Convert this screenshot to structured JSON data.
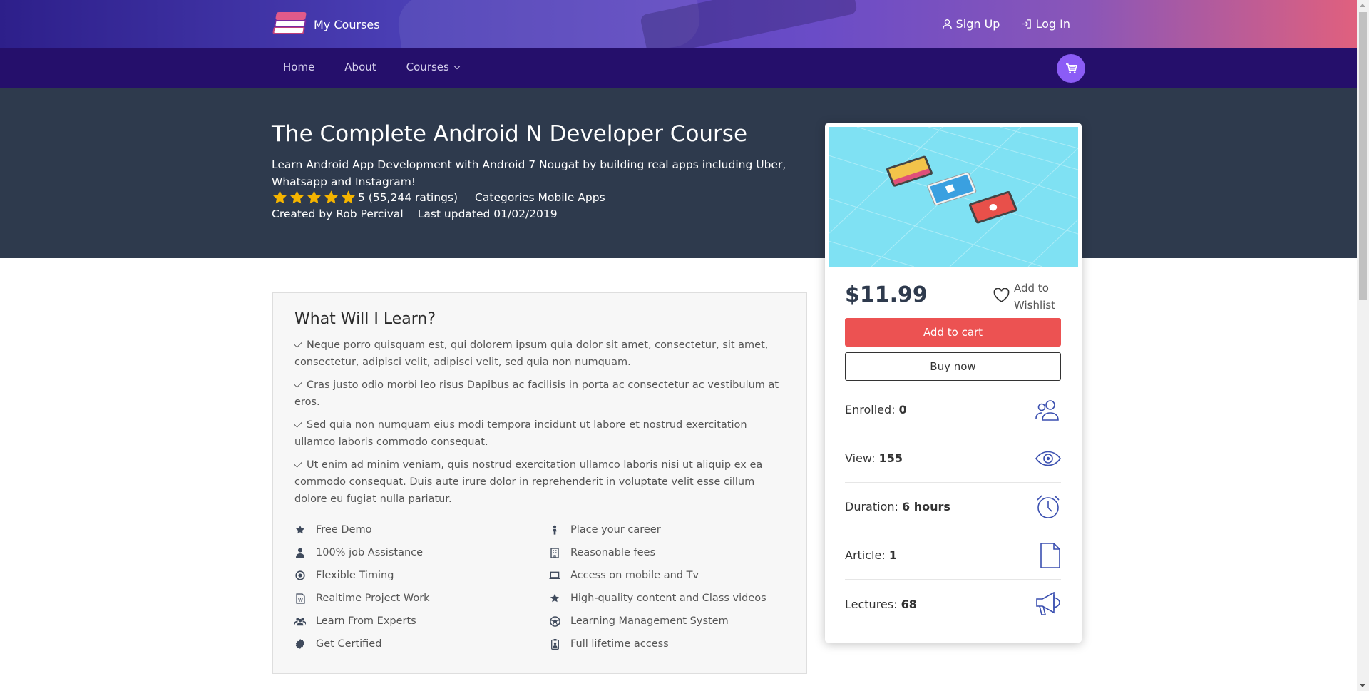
{
  "header": {
    "brand_name": "My Courses",
    "signup_label": "Sign Up",
    "login_label": "Log In"
  },
  "nav": {
    "items": [
      "Home",
      "About",
      "Courses"
    ],
    "cart_icon": "cart-icon"
  },
  "course": {
    "title": "The Complete Android N Developer Course",
    "subtitle": "Learn Android App Development with Android 7 Nougat by building real apps including Uber, Whatsapp and Instagram!",
    "rating_value": 5,
    "rating_text": "5 (55,244 ratings)",
    "categories_text": "Categories Mobile Apps",
    "created_by": "Created by Rob Percival",
    "last_updated": "Last updated 01/02/2019"
  },
  "learn": {
    "heading": "What Will I Learn?",
    "points": [
      "Neque porro quisquam est, qui dolorem ipsum quia dolor sit amet, consectetur, sit amet, consectetur, adipisci velit, adipisci velit, sed quia non numquam.",
      "Cras justo odio morbi leo risus Dapibus ac facilisis in porta ac consectetur ac vestibulum at eros.",
      "Sed quia non numquam eius modi tempora incidunt ut labore et nostrud exercitation ullamco laboris commodo consequat.",
      "Ut enim ad minim veniam, quis nostrud exercitation ullamco laboris nisi ut aliquip ex ea commodo consequat. Duis aute irure dolor in reprehenderit in voluptate velit esse cillum dolore eu fugiat nulla pariatur."
    ],
    "features_left": [
      {
        "label": "Free Demo",
        "icon": "star-icon"
      },
      {
        "label": "100% job Assistance",
        "icon": "user-icon"
      },
      {
        "label": "Flexible Timing",
        "icon": "clock-icon"
      },
      {
        "label": "Realtime Project Work",
        "icon": "document-icon"
      },
      {
        "label": "Learn From Experts",
        "icon": "users-icon"
      },
      {
        "label": "Get Certified",
        "icon": "badge-icon"
      }
    ],
    "features_right": [
      {
        "label": "Place your career",
        "icon": "person-icon"
      },
      {
        "label": "Reasonable fees",
        "icon": "building-icon"
      },
      {
        "label": "Access on mobile and Tv",
        "icon": "laptop-icon"
      },
      {
        "label": "High-quality content and Class videos",
        "icon": "star-icon"
      },
      {
        "label": "Learning Management System",
        "icon": "soccer-ball-icon"
      },
      {
        "label": "Full lifetime access",
        "icon": "id-badge-icon"
      }
    ]
  },
  "purchase": {
    "price": "$11.99",
    "wishlist_label_1": "Add to",
    "wishlist_label_2": "Wishlist",
    "add_to_cart": "Add to cart",
    "buy_now": "Buy now",
    "stats": [
      {
        "label": "Enrolled:",
        "value": "0",
        "icon": "users-icon"
      },
      {
        "label": "View:",
        "value": "155",
        "icon": "eye-icon"
      },
      {
        "label": "Duration:",
        "value": "6 hours",
        "icon": "alarm-clock-icon"
      },
      {
        "label": "Article:",
        "value": "1",
        "icon": "file-icon"
      },
      {
        "label": "Lectures:",
        "value": "68",
        "icon": "megaphone-icon"
      }
    ]
  },
  "colors": {
    "nav_bg": "#250f6b",
    "hero_bg": "#2e3a4d",
    "accent_cart": "#8b5cf6",
    "add_to_cart": "#ec5252",
    "star": "#f4b400",
    "stat_icon": "#3a4fb0"
  }
}
